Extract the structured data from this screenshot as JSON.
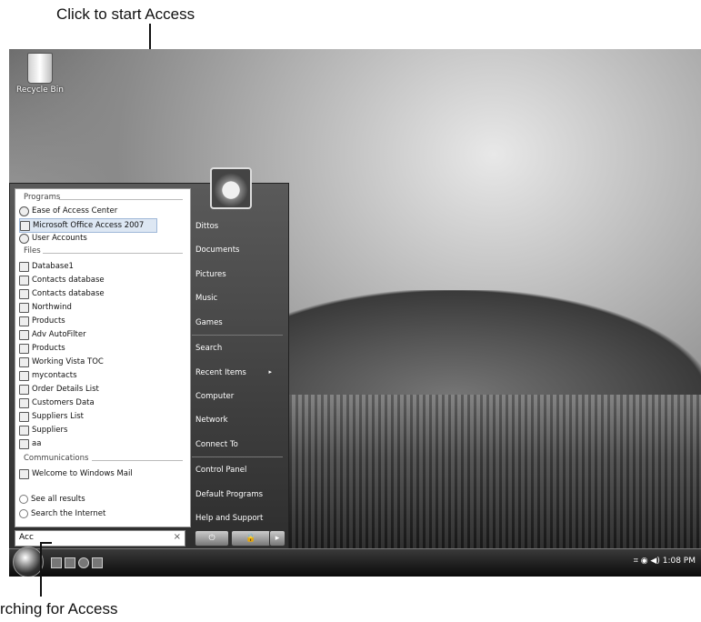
{
  "callouts": {
    "top": "Click to start Access",
    "bottom": "rching for Access"
  },
  "desktop": {
    "recycle_bin_label": "Recycle Bin"
  },
  "start_menu": {
    "sections": {
      "programs": "Programs",
      "files": "Files",
      "communications": "Communications"
    },
    "programs": [
      {
        "label": "Ease of Access Center",
        "icon": "ease-of-access-icon"
      },
      {
        "label": "Microsoft Office Access 2007",
        "icon": "access-icon"
      },
      {
        "label": "User Accounts",
        "icon": "user-accounts-icon"
      }
    ],
    "files": [
      "Database1",
      "Contacts database",
      "Contacts database",
      "Northwind",
      "Products",
      "Adv AutoFilter",
      "Products",
      "Working Vista TOC",
      "mycontacts",
      "Order Details List",
      "Customers Data",
      "Suppliers List",
      "Suppliers",
      "aa"
    ],
    "communications": [
      {
        "label": "Welcome to Windows Mail",
        "icon": "mail-icon"
      }
    ],
    "see_all_results": "See all results",
    "search_internet": "Search the Internet",
    "search_value": "Acc",
    "clear_glyph": "×",
    "right_items": [
      "Dittos",
      "Documents",
      "Pictures",
      "Music",
      "Games",
      "Search",
      "Recent Items",
      "Computer",
      "Network",
      "Connect To",
      "Control Panel",
      "Default Programs",
      "Help and Support"
    ],
    "power_glyph": "⏻",
    "lock_glyph": "🔒",
    "more_glyph": "▸"
  },
  "taskbar": {
    "clock": "1:08 PM"
  }
}
